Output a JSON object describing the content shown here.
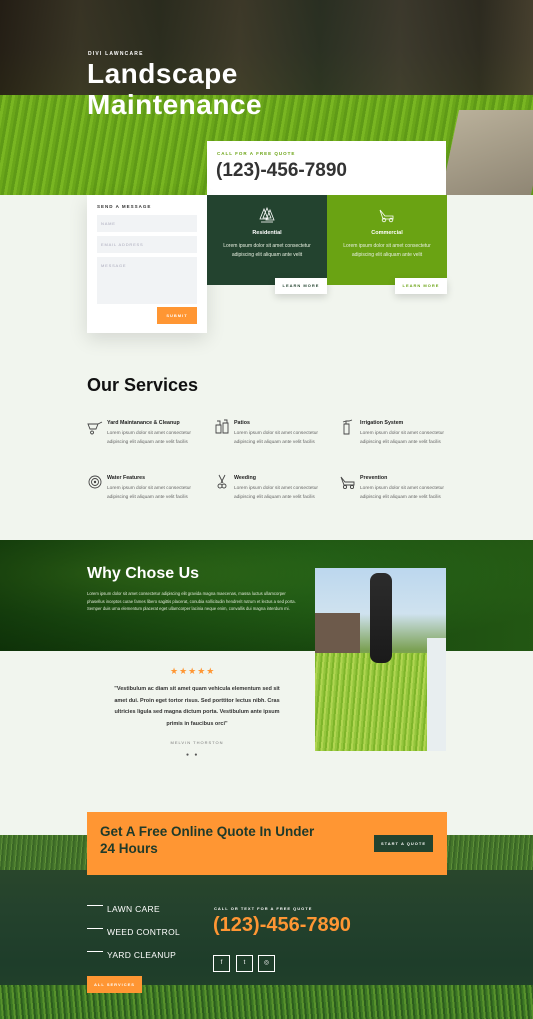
{
  "hero": {
    "eyebrow": "DIVI LAWNCARE",
    "title_line1": "Landscape",
    "title_line2": "Maintenance"
  },
  "quote_box": {
    "label": "CALL FOR A FREE QUOTE",
    "phone": "(123)-456-7890"
  },
  "form": {
    "label": "SEND A MESSAGE",
    "name_placeholder": "NAME",
    "email_placeholder": "EMAIL ADDRESS",
    "message_placeholder": "MESSAGE",
    "submit": "SUBMIT"
  },
  "cards": [
    {
      "title": "Residential",
      "desc": "Lorem ipsum dolor sit amet consectetur adipiscing elit aliquam ante velit",
      "button": "LEARN MORE",
      "icon": "trees-icon",
      "color": "#23432f"
    },
    {
      "title": "Commercial",
      "desc": "Lorem ipsum dolor sit amet consectetur adipiscing elit aliquam ante velit",
      "button": "LEARN MORE",
      "icon": "lawnmower-icon",
      "color": "#6aa313"
    }
  ],
  "services": {
    "heading": "Our Services",
    "items": [
      {
        "title": "Yard Maintanance & Cleanup",
        "desc": "Lorem ipsum dolor sit amet consectetur adipiscing elit aliquam ante velit facilis",
        "icon": "wheelbarrow-icon"
      },
      {
        "title": "Patios",
        "desc": "Lorem ipsum dolor sit amet consectetur adipiscing elit aliquam ante velit facilis",
        "icon": "patio-icon"
      },
      {
        "title": "Irrigation System",
        "desc": "Lorem ipsum dolor sit amet consectetur adipiscing elit aliquam ante velit facilis",
        "icon": "sprayer-icon"
      },
      {
        "title": "Water Features",
        "desc": "Lorem ipsum dolor sit amet consectetur adipiscing elit aliquam ante velit facilis",
        "icon": "hose-icon"
      },
      {
        "title": "Weeding",
        "desc": "Lorem ipsum dolor sit amet consectetur adipiscing elit aliquam ante velit facilis",
        "icon": "shears-icon"
      },
      {
        "title": "Prevention",
        "desc": "Lorem ipsum dolor sit amet consectetur adipiscing elit aliquam ante velit facilis",
        "icon": "mower-icon"
      }
    ]
  },
  "why": {
    "heading": "Why Chose Us",
    "body": "Lorem ipsum dolor sit amet consectetur adipiscing elit gravida magna maecenas, massa luctus ullamcorper phasellus inceptos curae fames libero sagittis placerat, conubia sollicitudin hendrerit rutrum et lectus a sed porta. Semper duis urna elementum placerat eget ullamcorper lacinia neque enim, convallis dui magna interdum mi."
  },
  "testimonial": {
    "stars": "★★★★★",
    "rating": 5,
    "quote": "\"Vestibulum ac diam sit amet quam vehicula elementum sed sit amet dui. Proin eget tortor risus. Sed porttitor lectus nibh. Cras ultricies ligula sed magna dictum porta. Vestibulum ante ipsum primis in faucibus orci\"",
    "author": "MELVIN THORSTON",
    "dots": "● ●"
  },
  "cta": {
    "title": "Get A Free Online Quote In Under 24 Hours",
    "button": "START A QUOTE"
  },
  "footer": {
    "links": [
      "LAWN CARE",
      "WEED CONTROL",
      "YARD CLEANUP"
    ],
    "label": "CALL OR TEXT FOR A FREE QUOTE",
    "phone": "(123)-456-7890",
    "social": [
      "f",
      "t",
      "◎"
    ],
    "all_button": "ALL SERVICES"
  }
}
